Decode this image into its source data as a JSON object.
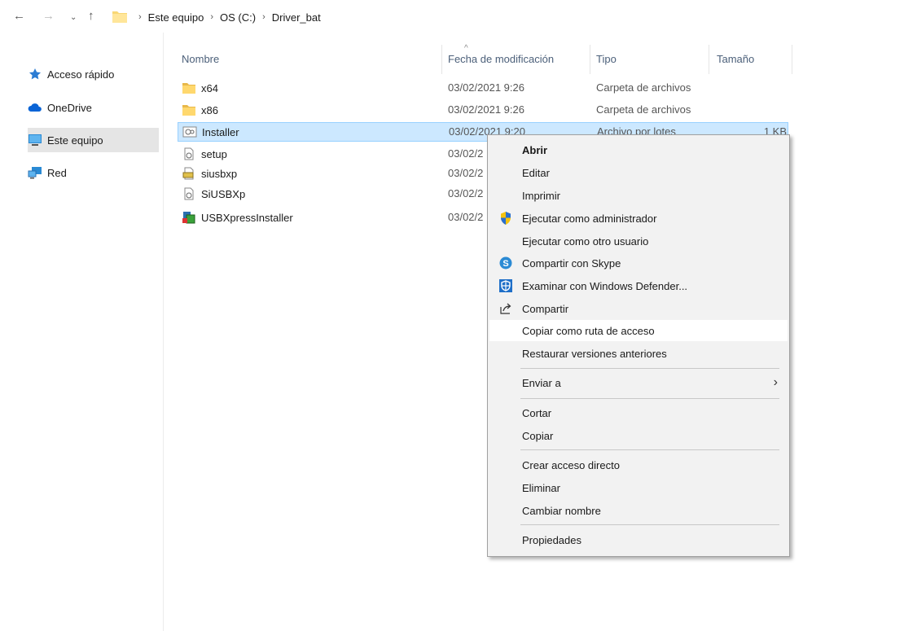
{
  "breadcrumb": [
    "Este equipo",
    "OS (C:)",
    "Driver_bat"
  ],
  "sidebar": {
    "items": [
      {
        "label": "Acceso rápido",
        "icon": "star-icon"
      },
      {
        "label": "OneDrive",
        "icon": "cloud-icon"
      },
      {
        "label": "Este equipo",
        "icon": "computer-icon"
      },
      {
        "label": "Red",
        "icon": "network-icon"
      }
    ]
  },
  "columns": {
    "name": "Nombre",
    "date": "Fecha de modificación",
    "type": "Tipo",
    "size": "Tamaño"
  },
  "files": [
    {
      "name": "x64",
      "date": "03/02/2021 9:26",
      "type": "Carpeta de archivos",
      "size": "",
      "icon": "folder-icon"
    },
    {
      "name": "x86",
      "date": "03/02/2021 9:26",
      "type": "Carpeta de archivos",
      "size": "",
      "icon": "folder-icon"
    },
    {
      "name": "Installer",
      "date": "03/02/2021 9:20",
      "type": "Archivo por lotes",
      "size": "1 KB",
      "icon": "batch-file-icon"
    },
    {
      "name": "setup",
      "date": "03/02/2",
      "type": "",
      "size": "",
      "icon": "settings-file-icon"
    },
    {
      "name": "siusbxp",
      "date": "03/02/2",
      "type": "",
      "size": "",
      "icon": "driver-file-icon"
    },
    {
      "name": "SiUSBXp",
      "date": "03/02/2",
      "type": "",
      "size": "",
      "icon": "settings-file-icon"
    },
    {
      "name": "USBXpressInstaller",
      "date": "03/02/2",
      "type": "",
      "size": "",
      "icon": "installer-icon"
    }
  ],
  "context_menu": {
    "items": [
      {
        "label": "Abrir",
        "bold": true
      },
      {
        "label": "Editar"
      },
      {
        "label": "Imprimir"
      },
      {
        "label": "Ejecutar como administrador",
        "icon": "uac-shield-icon"
      },
      {
        "label": "Ejecutar como otro usuario"
      },
      {
        "label": "Compartir con Skype",
        "icon": "skype-icon"
      },
      {
        "label": "Examinar con Windows Defender...",
        "icon": "defender-icon"
      },
      {
        "label": "Compartir",
        "icon": "share-icon"
      },
      {
        "label": "Copiar como ruta de acceso",
        "hover": true
      },
      {
        "label": "Restaurar versiones anteriores"
      },
      {
        "label": "Enviar a",
        "submenu": true
      },
      {
        "label": "Cortar"
      },
      {
        "label": "Copiar"
      },
      {
        "label": "Crear acceso directo"
      },
      {
        "label": "Eliminar"
      },
      {
        "label": "Cambiar nombre"
      },
      {
        "label": "Propiedades"
      }
    ]
  }
}
